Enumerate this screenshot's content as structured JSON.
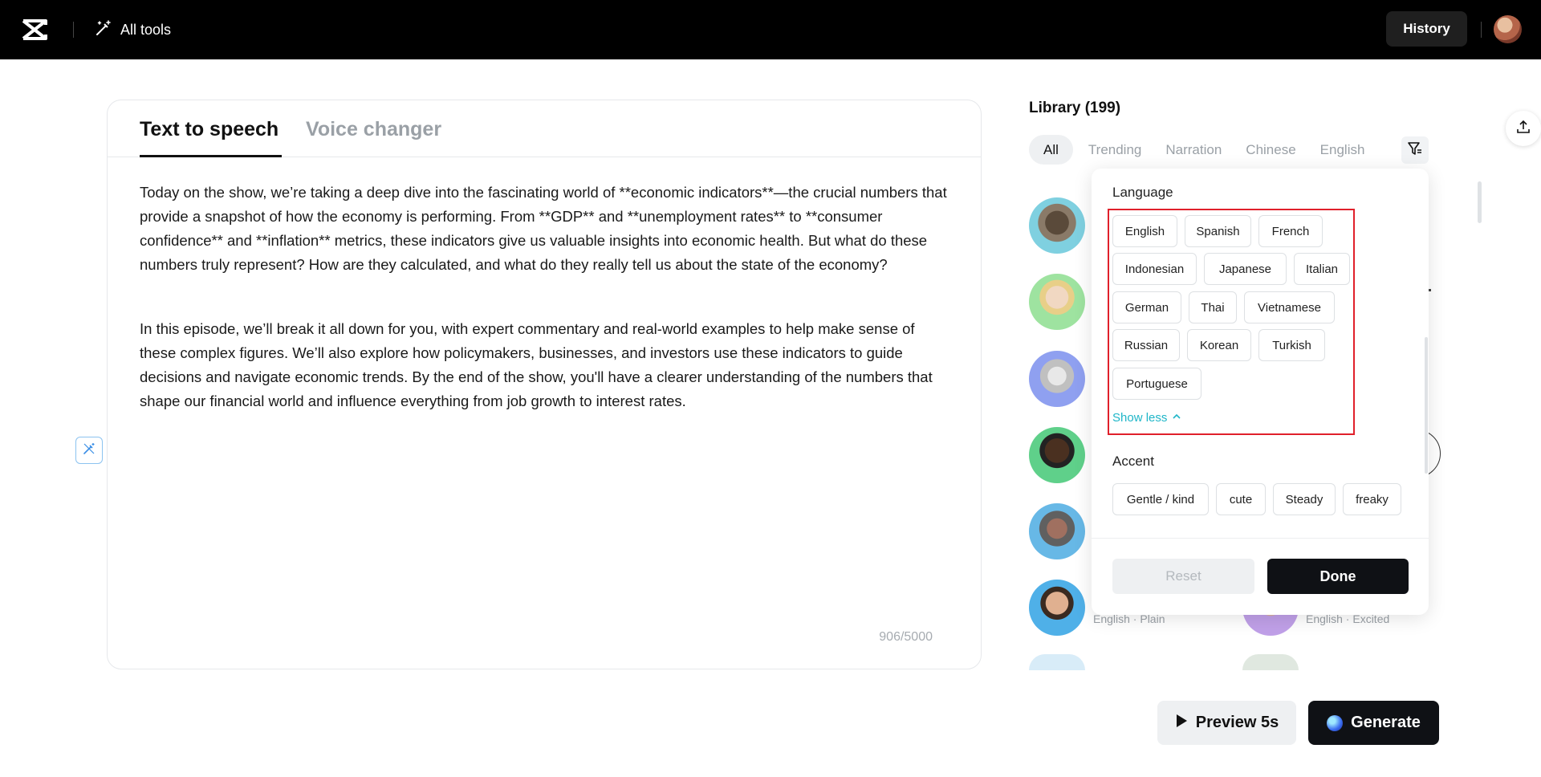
{
  "header": {
    "all_tools_label": "All tools",
    "history_label": "History"
  },
  "editor": {
    "tabs": [
      {
        "label": "Text to speech",
        "active": true
      },
      {
        "label": "Voice changer",
        "active": false
      }
    ],
    "paragraphs": [
      "Today on the show, we’re taking a deep dive into the fascinating world of **economic indicators**—the crucial numbers that provide a snapshot of how the economy is performing. From **GDP** and **unemployment rates** to **consumer confidence** and **inflation** metrics, these indicators give us valuable insights into economic health. But what do these numbers truly represent? How are they calculated, and what do they really tell us about the state of the economy?",
      "In this episode, we’ll break it all down for you, with expert commentary and real-world examples to help make sense of these complex figures. We’ll also explore how policymakers, businesses, and investors use these indicators to guide decisions and navigate economic trends. By the end of the show, you'll have a clearer understanding of the numbers that shape our financial world and influence everything from job growth to interest rates."
    ],
    "char_count": "906/5000"
  },
  "library": {
    "title": "Library (199)",
    "tabs": [
      "All",
      "Trending",
      "Narration",
      "Chinese",
      "English"
    ],
    "voice_meta": [
      "English · Plain",
      "English · Excited"
    ]
  },
  "filter": {
    "language_title": "Language",
    "languages": [
      "English",
      "Spanish",
      "French",
      "Indonesian",
      "Japanese",
      "Italian",
      "German",
      "Thai",
      "Vietnamese",
      "Russian",
      "Korean",
      "Turkish",
      "Portuguese"
    ],
    "show_less_label": "Show less",
    "accent_title": "Accent",
    "accents": [
      "Gentle / kind",
      "cute",
      "Steady",
      "freaky"
    ],
    "reset_label": "Reset",
    "done_label": "Done"
  },
  "actions": {
    "preview_label": "Preview 5s",
    "generate_label": "Generate"
  }
}
